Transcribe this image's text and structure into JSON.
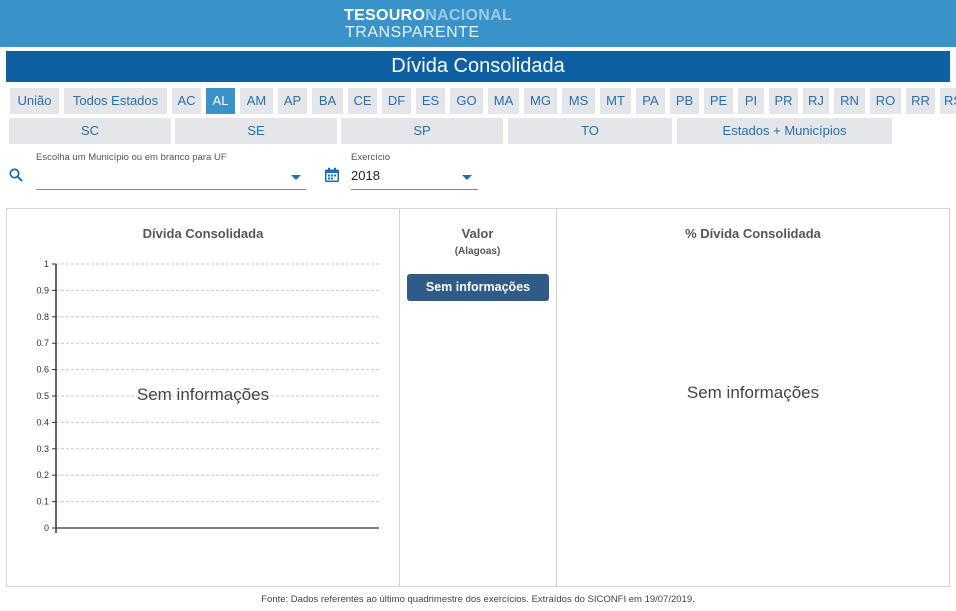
{
  "header": {
    "logo_line1_a": "TESOURO",
    "logo_line1_b": "NACIONAL",
    "logo_line2": "TRANSPARENTE",
    "bg_color": "#3a93c8"
  },
  "page_title": "Dívida Consolidada",
  "tabs_row1": [
    "União",
    "Todos Estados",
    "AC",
    "AL",
    "AM",
    "AP",
    "BA",
    "CE",
    "DF",
    "ES",
    "GO",
    "MA",
    "MG",
    "MS",
    "MT",
    "PA",
    "PB",
    "PE",
    "PI",
    "PR",
    "RJ",
    "RN",
    "RO",
    "RR",
    "RS"
  ],
  "tabs_row2": [
    "SC",
    "SE",
    "SP",
    "TO",
    "Estados + Municípios"
  ],
  "active_tab": "AL",
  "municipio": {
    "label": "Escolha um Município ou em branco para UF",
    "value": ""
  },
  "exercicio": {
    "label": "Exercício",
    "value": "2018"
  },
  "left_panel": {
    "title": "Dívida Consolidada",
    "no_info": "Sem informações"
  },
  "middle_panel": {
    "title": "Valor",
    "subtitle": "(Alagoas)",
    "button": "Sem informações"
  },
  "right_panel": {
    "title": "% Dívida Consolidada",
    "no_info": "Sem informações"
  },
  "chart_data": {
    "type": "bar",
    "title": "Dívida Consolidada",
    "categories": [],
    "values": [],
    "ylim": [
      0,
      1
    ],
    "yticks": [
      "0",
      "0.1",
      "0.2",
      "0.3",
      "0.4",
      "0.5",
      "0.6",
      "0.7",
      "0.8",
      "0.9",
      "1"
    ],
    "grid": true
  },
  "footer": "Fonte: Dados referentes ao último quadrimestre dos exercícios. Extraídos do SICONFI em 19/07/2019."
}
